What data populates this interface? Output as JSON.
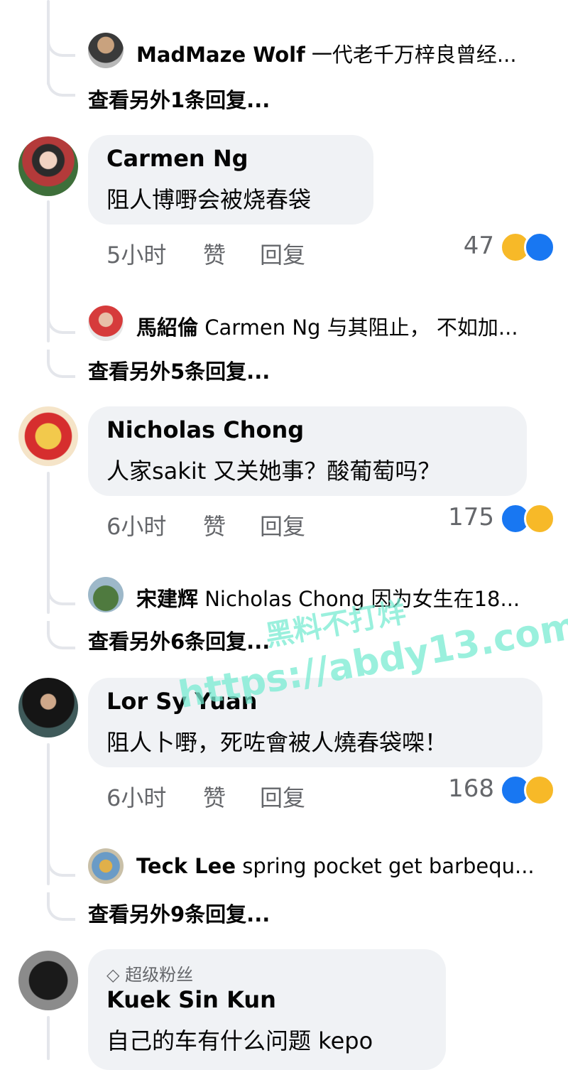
{
  "threads": [
    {
      "replies": [
        {
          "name": "MadMaze Wolf",
          "text": "一代老千万梓良曾经..."
        }
      ],
      "more": "查看另外1条回复..."
    },
    {
      "author": "Carmen Ng",
      "text": "阻人博嘢会被烧春袋",
      "time": "5小时",
      "like": "赞",
      "reply": "回复",
      "reactions_count": "47",
      "reply_preview": {
        "name": "馬紹倫",
        "text": "Carmen Ng 与其阻止， 不如加..."
      },
      "more": "查看另外5条回复..."
    },
    {
      "author": "Nicholas Chong",
      "text": "人家sakit 又关她事？酸葡萄吗？",
      "time": "6小时",
      "like": "赞",
      "reply": "回复",
      "reactions_count": "175",
      "reply_preview": {
        "name": "宋建辉",
        "text": "Nicholas Chong 因为女生在18..."
      },
      "more": "查看另外6条回复..."
    },
    {
      "author": "Lor Sy Yuan",
      "text": "阻人卜嘢，死咗會被人燒春袋㗎！",
      "time": "6小时",
      "like": "赞",
      "reply": "回复",
      "reactions_count": "168",
      "reply_preview": {
        "name": "Teck Lee",
        "text": "spring pocket get barbequ..."
      },
      "more": "查看另外9条回复..."
    },
    {
      "badge": "超级粉丝",
      "author": "Kuek Sin Kun",
      "text": "自己的车有什么问题 kepo"
    }
  ],
  "watermark": {
    "line1": "黑料不打烊",
    "line2": "https://abdy13.com"
  },
  "colors": {
    "bubble": "#f0f2f5",
    "meta": "#65676b",
    "like": "#1877f2",
    "haha": "#f7b928",
    "line": "#e4e6eb"
  }
}
